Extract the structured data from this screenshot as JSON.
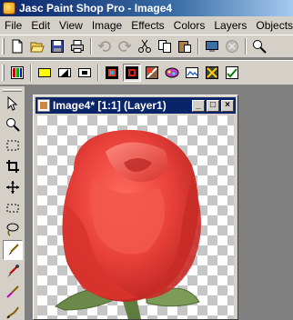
{
  "window": {
    "title": "Jasc Paint Shop Pro - Image4"
  },
  "menu": {
    "items": [
      "File",
      "Edit",
      "View",
      "Image",
      "Effects",
      "Colors",
      "Layers",
      "Objects"
    ]
  },
  "toolbar1": {
    "icons": [
      "new-icon",
      "open-icon",
      "save-icon",
      "print-icon",
      "undo-icon",
      "redo-icon",
      "cut-icon",
      "copy-icon",
      "paste-icon",
      "browser-icon",
      "stop-icon",
      "zoom-icon"
    ]
  },
  "toolbar2": {
    "icons": [
      "palette-icon",
      "color-yellow-icon",
      "fill-icon",
      "layer-icon",
      "overview-icon",
      "histogram-icon",
      "tool-options-icon",
      "script-icon",
      "effect-browser-icon",
      "animation-icon",
      "ok-icon"
    ]
  },
  "tools": {
    "icons": [
      "arrow-icon",
      "zoom-icon",
      "selection-icon",
      "crop-icon",
      "move-icon",
      "freehand-selection-icon",
      "lasso-icon",
      "paintbrush-icon",
      "dropper-icon",
      "clone-brush-icon",
      "retouch-icon"
    ]
  },
  "image_window": {
    "title": "Image4* [1:1] (Layer1)",
    "minimize_label": "_",
    "maximize_label": "□",
    "close_label": "×"
  },
  "colors": {
    "title_gradient_start": "#0a246a",
    "title_gradient_end": "#a6caf0",
    "chrome": "#d4d0c8",
    "workspace": "#808080",
    "rose": "#e8403a",
    "leaf": "#6b8a4a"
  }
}
